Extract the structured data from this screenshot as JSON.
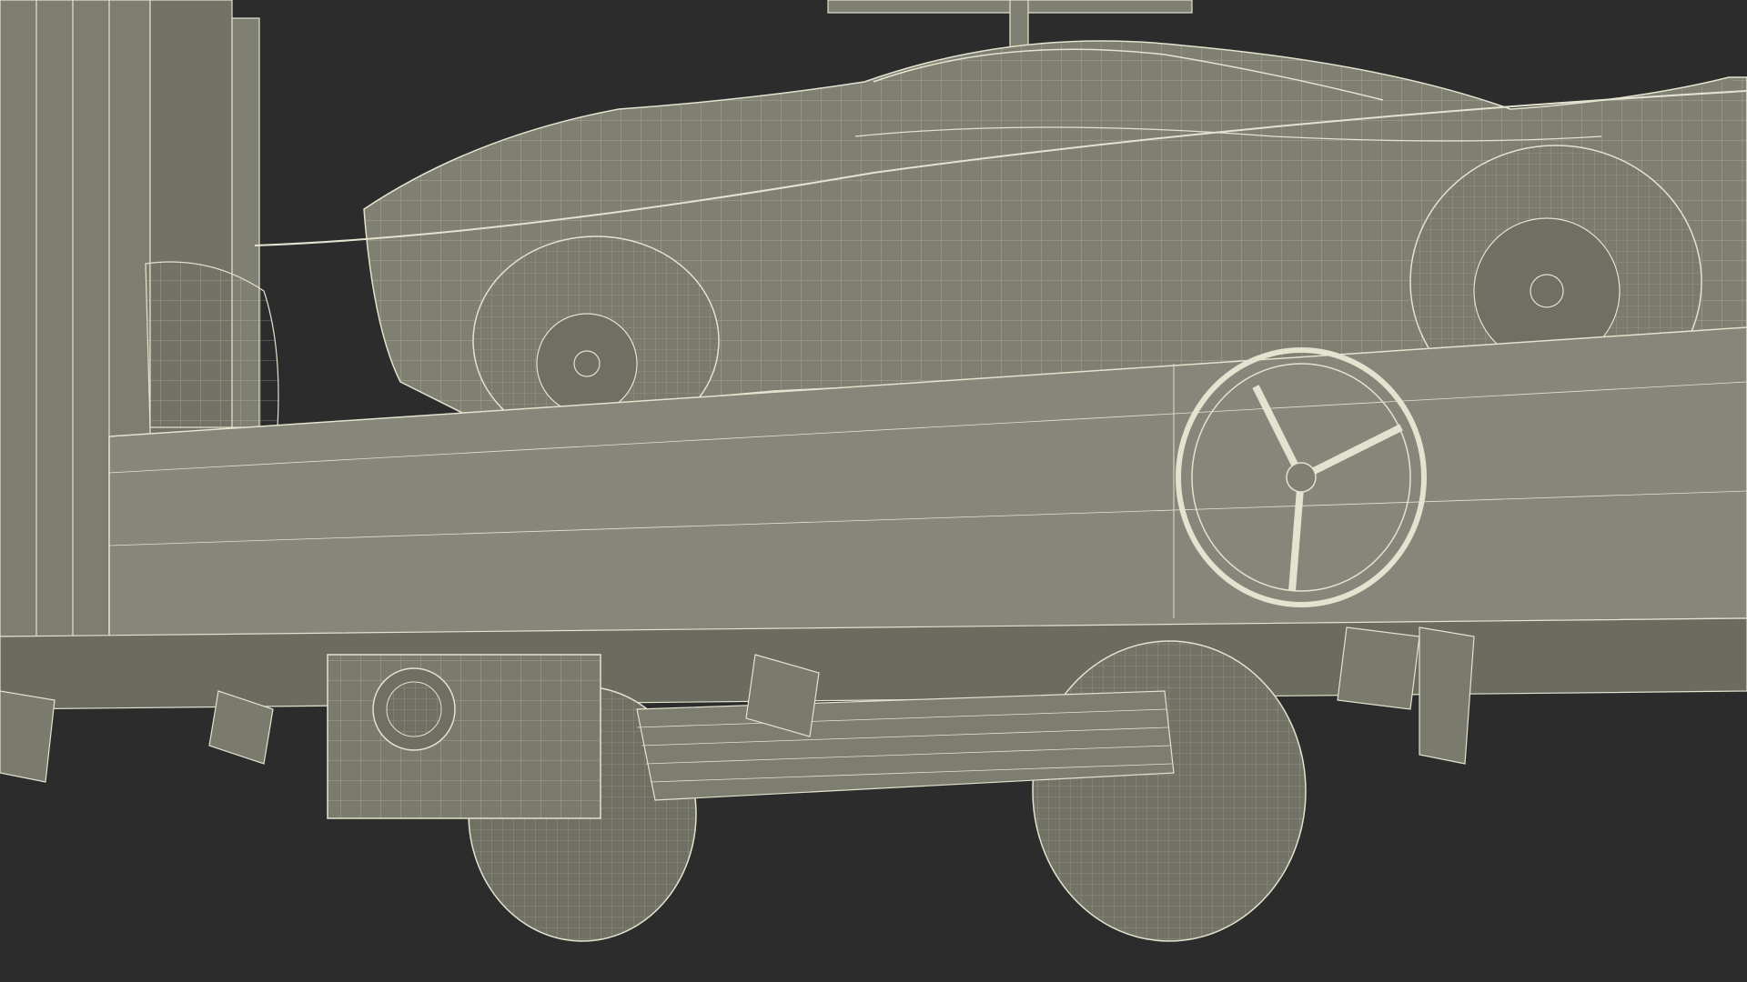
{
  "scene": {
    "subject": "wireframe-render",
    "colors": {
      "background": "#2c2c2c",
      "surface": "#7f7f72",
      "surface_dark": "#6b6b60",
      "surface_light": "#8e8e80",
      "wire": "#e3e3cf",
      "wire_dim": "#b9b9a6"
    }
  }
}
